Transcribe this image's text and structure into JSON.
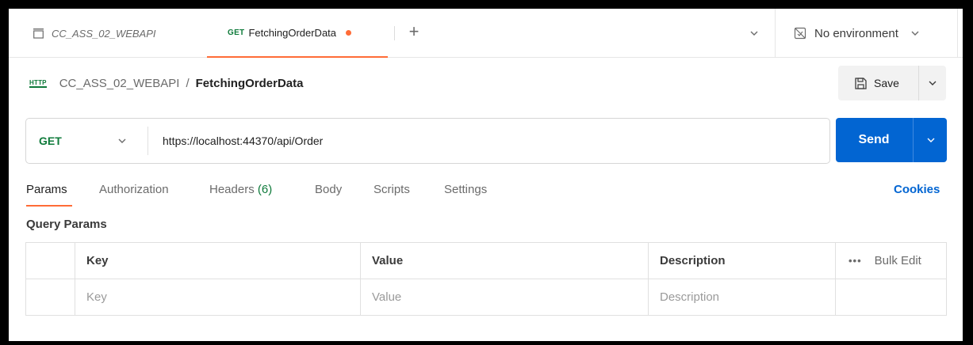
{
  "tabs": {
    "collection": "CC_ASS_02_WEBAPI",
    "active": {
      "method": "GET",
      "name": "FetchingOrderData"
    },
    "new_tab": "+"
  },
  "environment": {
    "label": "No environment"
  },
  "breadcrumb": {
    "icon_text": "HTTP",
    "collection": "CC_ASS_02_WEBAPI",
    "separator": "/",
    "request": "FetchingOrderData"
  },
  "save": {
    "label": "Save"
  },
  "request": {
    "method": "GET",
    "url": "https://localhost:44370/api/Order",
    "send_label": "Send"
  },
  "request_tabs": [
    {
      "label": "Params"
    },
    {
      "label": "Authorization"
    },
    {
      "label": "Headers",
      "count": "(6)"
    },
    {
      "label": "Body"
    },
    {
      "label": "Scripts"
    },
    {
      "label": "Settings"
    }
  ],
  "cookies": "Cookies",
  "query_params": {
    "title": "Query Params",
    "headers": {
      "key": "Key",
      "value": "Value",
      "description": "Description",
      "bulk_edit": "Bulk Edit",
      "more": "•••"
    },
    "placeholders": {
      "key": "Key",
      "value": "Value",
      "description": "Description"
    }
  },
  "colors": {
    "accent": "#ff6c37",
    "send": "#0265d2",
    "method_get": "#0e7a3a"
  }
}
